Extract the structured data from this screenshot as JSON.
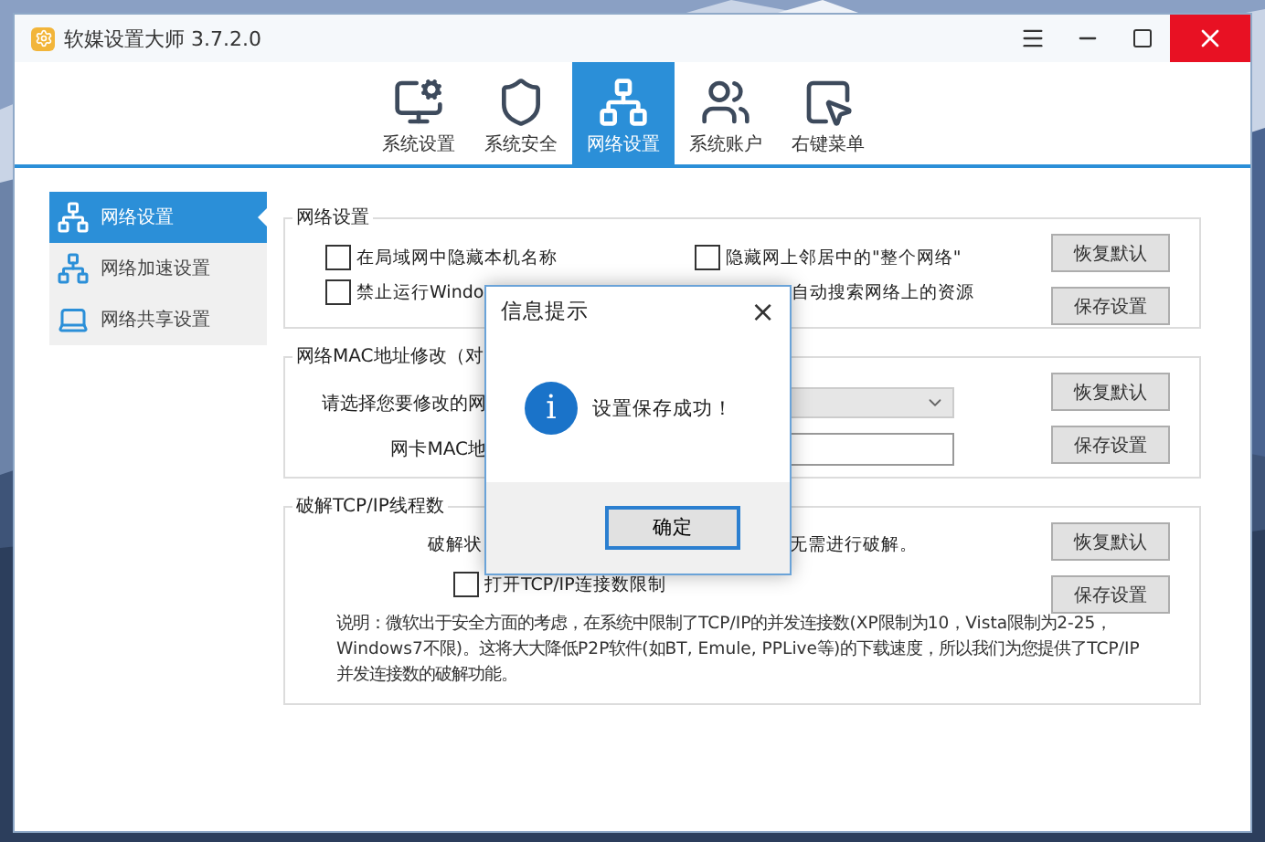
{
  "window": {
    "title": "软媒设置大师 3.7.2.0"
  },
  "tabs": [
    {
      "label": "系统设置",
      "selected": false
    },
    {
      "label": "系统安全",
      "selected": false
    },
    {
      "label": "网络设置",
      "selected": true
    },
    {
      "label": "系统账户",
      "selected": false
    },
    {
      "label": "右键菜单",
      "selected": false
    }
  ],
  "sidebar": {
    "items": [
      {
        "label": "网络设置",
        "selected": true
      },
      {
        "label": "网络加速设置",
        "selected": false
      },
      {
        "label": "网络共享设置",
        "selected": false
      }
    ]
  },
  "groups": [
    {
      "title": "网络设置",
      "checkboxes": [
        {
          "label": "在局域网中隐藏本机名称",
          "checked": false,
          "kind": "full"
        },
        {
          "label": "隐藏网上邻居中的\"整个网络\"",
          "checked": false,
          "kind": "full"
        },
        {
          "label": "禁止运行Windo",
          "checked": false,
          "kind": "full"
        },
        {
          "label": "自动搜索网络上的资源",
          "kind": "fragment"
        }
      ],
      "buttons": [
        "恢复默认",
        "保存设置"
      ]
    },
    {
      "title": "网络MAC地址修改（对",
      "fields": [
        {
          "label": "请选择您要修改的网",
          "kind": "select"
        },
        {
          "label": "网卡MAC地",
          "kind": "input"
        }
      ],
      "buttons": [
        "恢复默认",
        "保存设置"
      ]
    },
    {
      "title": "破解TCP/IP线程数",
      "status": {
        "label": "破解状",
        "value": "无需进行破解。"
      },
      "checkboxes": [
        {
          "label": "打开TCP/IP连接数限制",
          "checked": false,
          "kind": "single"
        }
      ],
      "note": "说明：微软出于安全方面的考虑，在系统中限制了TCP/IP的并发连接数(XP限制为10，Vista限制为2-25，Windows7不限)。这将大大降低P2P软件(如BT, Emule, PPLive等)的下载速度，所以我们为您提供了TCP/IP并发连接数的破解功能。",
      "buttons": [
        "恢复默认",
        "保存设置"
      ]
    }
  ],
  "dialog": {
    "title": "信息提示",
    "close": "×",
    "message": "设置保存成功！",
    "icon": "i",
    "button": "确定"
  }
}
